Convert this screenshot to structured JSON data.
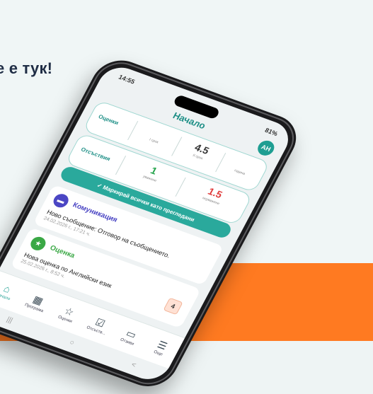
{
  "headline": "е е тук!",
  "status": {
    "time": "14:55",
    "battery": "81%"
  },
  "app": {
    "title": "Начало",
    "avatar": "AH"
  },
  "grades_card": {
    "label": "Оценки",
    "cells": [
      {
        "value": "",
        "sub": "I срок"
      },
      {
        "value": "4.5",
        "sub": "II срок"
      },
      {
        "value": "",
        "sub": "година"
      }
    ]
  },
  "absence_card": {
    "label": "Отсъствия",
    "cells": [
      {
        "value": "1",
        "sub": "уважени",
        "color": "#22a34a"
      },
      {
        "value": "1.5",
        "sub": "неуважени",
        "color": "#e03b3b"
      }
    ]
  },
  "mark_all_button": "✓ Маркирай всички като прегледани",
  "notifications": [
    {
      "title": "Комуникация",
      "text": "Ново съобщение: Отговор на съобщението.",
      "date": "24.02.2026 г., 17:21 ч.",
      "icon": "chat-icon",
      "color": "#4b46c4"
    },
    {
      "title": "Оценка",
      "text": "Нова оценка по Английски език",
      "date": "25.02.2026 г., 8:52 ч.",
      "icon": "star-icon",
      "color": "#3aa845",
      "grade": "4"
    }
  ],
  "tabs": [
    {
      "label": "Начало",
      "icon": "home-icon",
      "glyph": "⌂"
    },
    {
      "label": "Програма",
      "icon": "calendar-icon",
      "glyph": "▦"
    },
    {
      "label": "Оценки",
      "icon": "star-icon",
      "glyph": "☆"
    },
    {
      "label": "Отсъств...",
      "icon": "checklist-icon",
      "glyph": "☑"
    },
    {
      "label": "Отзиви",
      "icon": "clipboard-icon",
      "glyph": "▭"
    },
    {
      "label": "Още",
      "icon": "menu-icon",
      "glyph": "☰"
    }
  ],
  "colors": {
    "accent": "#1e9e92",
    "orange": "#ff7a21"
  }
}
